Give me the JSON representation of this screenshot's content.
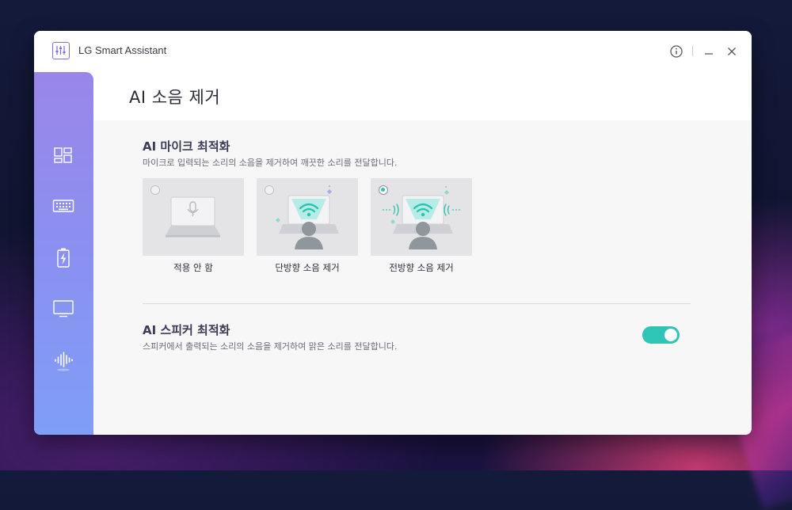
{
  "window": {
    "app_title": "LG Smart Assistant"
  },
  "titlebar": {
    "info_icon": "info-icon",
    "minimize_icon": "minimize-icon",
    "close_icon": "close-icon"
  },
  "sidebar": {
    "items": [
      {
        "icon": "dashboard-icon"
      },
      {
        "icon": "keyboard-icon"
      },
      {
        "icon": "battery-charging-icon"
      },
      {
        "icon": "monitor-icon"
      },
      {
        "icon": "sound-wave-icon",
        "active": true
      }
    ]
  },
  "page": {
    "title": "AI 소음 제거"
  },
  "mic_section": {
    "title": "AI 마이크 최적화",
    "description": "마이크로 입력되는 소리의 소음을 제거하여 깨끗한 소리를 전달합니다.",
    "options": [
      {
        "label": "적용 안 함",
        "selected": false
      },
      {
        "label": "단방향 소음 제거",
        "selected": false
      },
      {
        "label": "전방향 소음 제거",
        "selected": true
      }
    ]
  },
  "speaker_section": {
    "title": "AI 스피커 최적화",
    "description": "스피커에서 출력되는 소리의 소음을 제거하여 맑은 소리를 전달합니다.",
    "enabled": true
  },
  "colors": {
    "accent": "#2ec4b6",
    "sidebar_top": "#9a86ea",
    "sidebar_bottom": "#7f9ef5"
  }
}
